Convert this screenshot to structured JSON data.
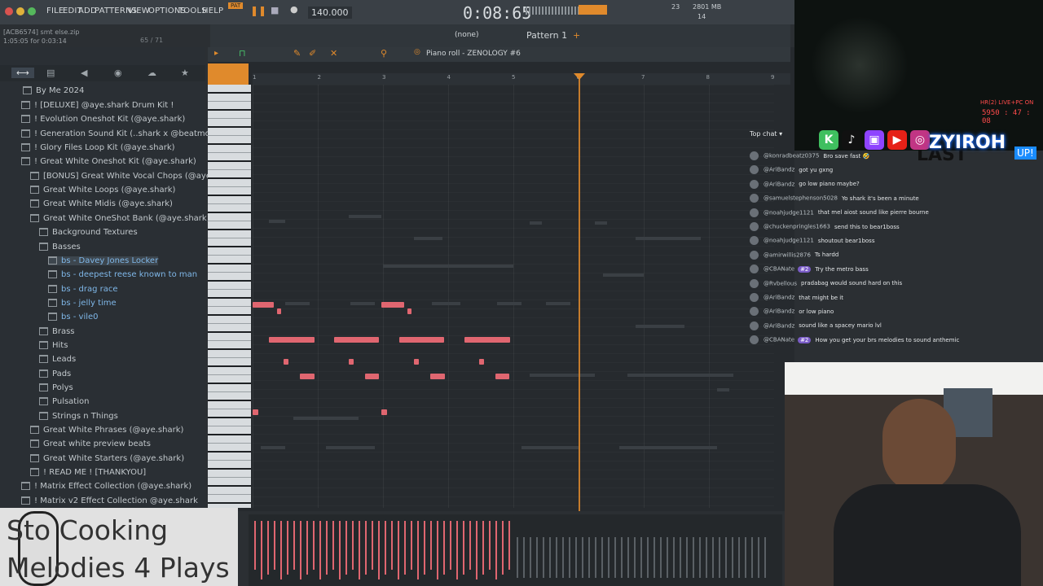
{
  "menu": [
    "FILE",
    "EDIT",
    "ADD",
    "PATTERNS",
    "VIEW",
    "OPTIONS",
    "TOOLS",
    "HELP"
  ],
  "transport": {
    "mode": "PAT",
    "tempo": "140.000",
    "time": "0:08:65",
    "cpu": "23",
    "memory": "2801 MB",
    "voices": "14"
  },
  "hint": {
    "line1": "[ACB6574] smt else.zip",
    "line2": "1:05:05 for 0:03:14",
    "counter": "65 / 71"
  },
  "toolbar": {
    "pattern": "Pattern 1",
    "channel": "(none)",
    "piano_roll_title": "Piano roll - ZENOLOGY #6"
  },
  "browser": {
    "tabs": [
      "All",
      "Plugins",
      "Sounds"
    ],
    "root": "By Me 2024",
    "items": [
      {
        "label": "! [DELUXE] @aye.shark Drum Kit !",
        "indent": 1
      },
      {
        "label": "! Evolution Oneshot Kit (@aye.shark)",
        "indent": 1
      },
      {
        "label": "! Generation Sound Kit (..shark x @beatmonsterkc)",
        "indent": 1
      },
      {
        "label": "! Glory Files Loop Kit (@aye.shark)",
        "indent": 1
      },
      {
        "label": "! Great White Oneshot Kit (@aye.shark)",
        "indent": 1
      },
      {
        "label": "[BONUS] Great White Vocal Chops (@aye.shark)",
        "indent": 2
      },
      {
        "label": "Great White Loops (@aye.shark)",
        "indent": 2
      },
      {
        "label": "Great White Midis (@aye.shark)",
        "indent": 2
      },
      {
        "label": "Great White OneShot Bank (@aye.shark)",
        "indent": 2
      },
      {
        "label": "Background Textures",
        "indent": 3
      },
      {
        "label": "Basses",
        "indent": 3
      },
      {
        "label": "bs - Davey Jones Locker",
        "indent": 4
      },
      {
        "label": "bs - deepest reese known to man",
        "indent": 4
      },
      {
        "label": "bs - drag race",
        "indent": 4
      },
      {
        "label": "bs - jelly time",
        "indent": 4
      },
      {
        "label": "bs - vile0",
        "indent": 4
      },
      {
        "label": "Brass",
        "indent": 3
      },
      {
        "label": "Hits",
        "indent": 3
      },
      {
        "label": "Leads",
        "indent": 3
      },
      {
        "label": "Pads",
        "indent": 3
      },
      {
        "label": "Polys",
        "indent": 3
      },
      {
        "label": "Pulsation",
        "indent": 3
      },
      {
        "label": "Strings n Things",
        "indent": 3
      },
      {
        "label": "Great White Phrases (@aye.shark)",
        "indent": 2
      },
      {
        "label": "Great white preview beats",
        "indent": 2
      },
      {
        "label": "Great White Starters (@aye.shark)",
        "indent": 2
      },
      {
        "label": "! READ ME ! [THANKYOU]",
        "indent": 2
      },
      {
        "label": "! Matrix Effect Collection (@aye.shark)",
        "indent": 1
      },
      {
        "label": "! Matrix v2 Effect Collection @aye.shark",
        "indent": 1
      }
    ]
  },
  "ruler": [
    "1",
    "2",
    "3",
    "4",
    "5",
    "6",
    "7",
    "8",
    "9"
  ],
  "chat": {
    "header": "Top chat",
    "messages": [
      {
        "user": "@konradbeatz0375",
        "text": "Bro save fast 🤣"
      },
      {
        "user": "@AriBandz",
        "text": "got yu gxng"
      },
      {
        "user": "@AriBandz",
        "text": "go low piano maybe?"
      },
      {
        "user": "@samuelstephenson5028",
        "text": "Yo shark it's been a minute"
      },
      {
        "user": "@noahjudge1121",
        "text": "that mel aiost sound like pierre bourne"
      },
      {
        "user": "@chuckenpringles1663",
        "text": "send this to bear1boss"
      },
      {
        "user": "@noahjudge1121",
        "text": "shoutout bear1boss"
      },
      {
        "user": "@amirwillis2876",
        "text": "Ts hardd"
      },
      {
        "user": "@CBANate",
        "text": "Try the metro bass",
        "badge": "#2"
      },
      {
        "user": "@Rvbellous",
        "text": "pradabag would sound hard on this"
      },
      {
        "user": "@AriBandz",
        "text": "that might be it"
      },
      {
        "user": "@AriBandz",
        "text": "or low piano"
      },
      {
        "user": "@AriBandz",
        "text": "sound like a spacey mario lvl"
      },
      {
        "user": "@CBANate",
        "text": "How you get your brs melodies to sound anthemic",
        "badge": "#2"
      }
    ]
  },
  "stream": {
    "handle": "ZYIROH",
    "overlay_line1": "Sto Cooking",
    "overlay_line2": "Melodies 4 Plays",
    "cam_label": "HR(2) LIVE+PC ON",
    "cam_time": "5950 : 47 : 08",
    "cam_word": "LAST",
    "badge": "UP!"
  },
  "colors": {
    "note": "#e06670",
    "playhead": "#e08a2c",
    "accent_green": "#3fbf5f"
  }
}
